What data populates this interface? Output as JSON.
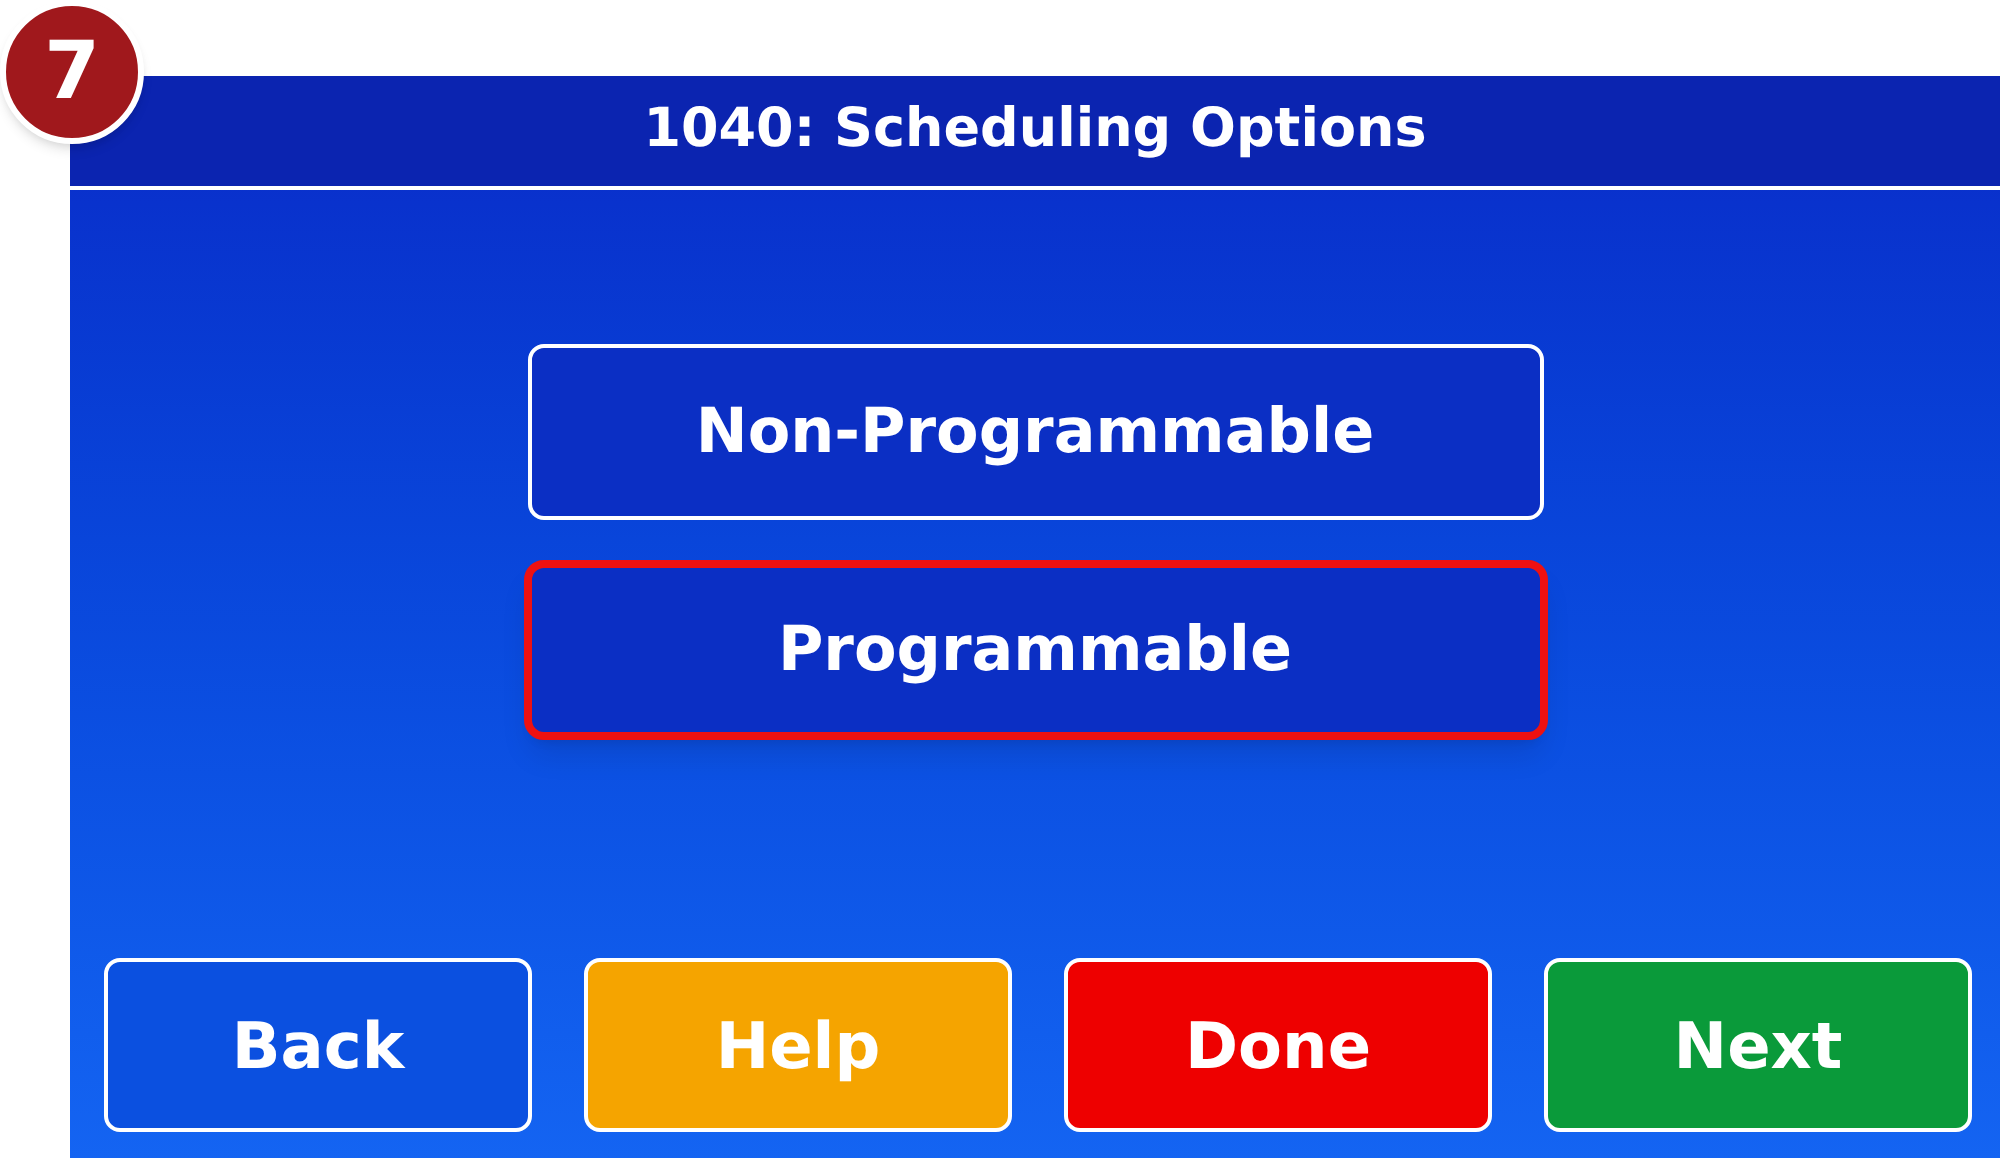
{
  "step_badge": "7",
  "title": "1040: Scheduling Options",
  "options": [
    {
      "label": "Non-Programmable",
      "selected": false
    },
    {
      "label": "Programmable",
      "selected": true
    }
  ],
  "buttons": [
    {
      "label": "Back",
      "color": "#0b50e0"
    },
    {
      "label": "Help",
      "color": "#f5a400"
    },
    {
      "label": "Done",
      "color": "#ee0000"
    },
    {
      "label": "Next",
      "color": "#0a9a3a"
    }
  ]
}
